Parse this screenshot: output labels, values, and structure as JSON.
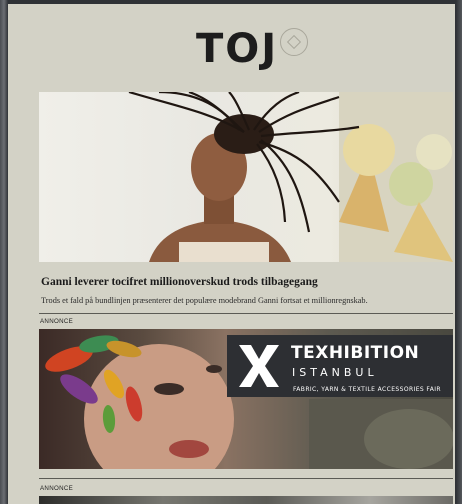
{
  "brand": {
    "logo_text": "TOJ"
  },
  "article": {
    "headline": "Ganni leverer tocifret millionoverskud trods tilbagegang",
    "lead": "Trods et fald på bundlinjen præsenterer det populære modebrand Ganni fortsat et millionregnskab."
  },
  "ads": [
    {
      "label": "ANNONCE",
      "title": "TEXHIBITION",
      "subtitle": "ISTANBUL",
      "tagline": "FABRIC, YARN & TEXTILE ACCESSORIES FAIR"
    },
    {
      "label": "ANNONCE"
    }
  ],
  "colors": {
    "page_background": "#d3d2c6",
    "ad_panel": "#2d2f33"
  }
}
